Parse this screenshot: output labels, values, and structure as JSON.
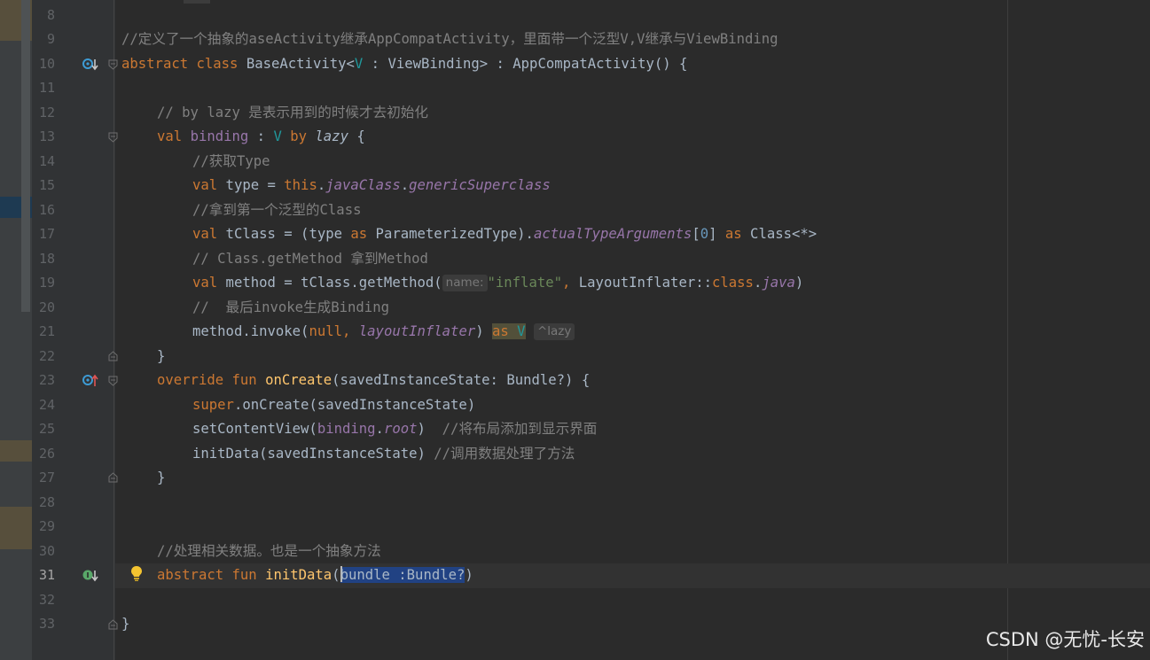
{
  "editor": {
    "language": "kotlin",
    "current_line": "31",
    "line_numbers": [
      "8",
      "9",
      "10",
      "11",
      "12",
      "13",
      "14",
      "15",
      "16",
      "17",
      "18",
      "19",
      "20",
      "21",
      "22",
      "23",
      "24",
      "25",
      "26",
      "27",
      "28",
      "29",
      "30",
      "31",
      "32",
      "33"
    ],
    "code": {
      "l9": {
        "comment": "//定义了一个抽象的aseActivity继承AppCompatActivity，里面带一个泛型V,V继承与ViewBinding"
      },
      "l10": {
        "abstract": "abstract",
        "class": "class",
        "name": "BaseActivity<",
        "type_param": "V",
        "rest": " : ViewBinding> : AppCompatActivity() {"
      },
      "l12": {
        "comment": "// by lazy 是表示用到的时候才去初始化"
      },
      "l13": {
        "val": "val",
        "prop": "binding",
        "colon": " : ",
        "type_param": "V",
        "by": "by",
        "lazy": "lazy",
        "brace": " {"
      },
      "l14": {
        "comment": "//获取Type"
      },
      "l15": {
        "val": "val",
        "name": " type = ",
        "this": "this",
        "dot1": ".",
        "javaClass": "javaClass",
        "dot2": ".",
        "generic": "genericSuperclass"
      },
      "l16": {
        "comment": "//拿到第一个泛型的Class"
      },
      "l17": {
        "val": "val",
        "name": " tClass = (type ",
        "as1": "as",
        "mid": " ParameterizedType).",
        "actual": "actualTypeArguments",
        "br1": "[",
        "zero": "0",
        "br2": "] ",
        "as2": "as",
        "end": " Class<*>"
      },
      "l18": {
        "comment": "// Class.getMethod 拿到Method"
      },
      "l19": {
        "val": "val",
        "name": " method = tClass.getMethod(",
        "hint": "name:",
        "str": "\"inflate\"",
        "comma": ", ",
        "inflater": "LayoutInflater::",
        "class": "class",
        "dot": ".",
        "java": "java",
        "end": ")"
      },
      "l20": {
        "comment": "//  最后invoke生成Binding"
      },
      "l21": {
        "call": "method.invoke(",
        "null": "null,",
        "space": " ",
        "li": "layoutInflater",
        "close": ") ",
        "as": "as",
        "type_param": " V",
        "hint": "^lazy"
      },
      "l22": {
        "brace": "}"
      },
      "l23": {
        "override": "override",
        "fun": "fun",
        "name": "onCreate",
        "rest": "(savedInstanceState: Bundle?) {"
      },
      "l24": {
        "super": "super",
        "rest": ".onCreate(savedInstanceState)"
      },
      "l25": {
        "call": "setContentView(",
        "binding": "binding",
        "dot": ".",
        "root": "root",
        "close": ")",
        "comment": "//将布局添加到显示界面"
      },
      "l26": {
        "call": "initData(savedInstanceState)",
        "comment": "//调用数据处理了方法"
      },
      "l27": {
        "brace": "}"
      },
      "l30": {
        "comment": "//处理相关数据。也是一个抽象方法"
      },
      "l31": {
        "abstract": "abstract",
        "fun": "fun",
        "name": "initData",
        "open": "(",
        "selected": "bundle :Bundle?",
        "close": ")"
      },
      "l33": {
        "brace": "}"
      }
    }
  },
  "watermark": "CSDN @无忧-长安",
  "colors": {
    "background": "#2b2b2b",
    "keyword": "#cc7832",
    "comment": "#808080",
    "type_param": "#20999d",
    "function": "#ffc66d",
    "property": "#9876aa",
    "string": "#6a8759",
    "number": "#6897bb",
    "selection": "#214283"
  },
  "icons": [
    "override-down-icon",
    "implementation-up-icon",
    "implemented-down-icon",
    "lightbulb-icon",
    "fold-icon"
  ]
}
